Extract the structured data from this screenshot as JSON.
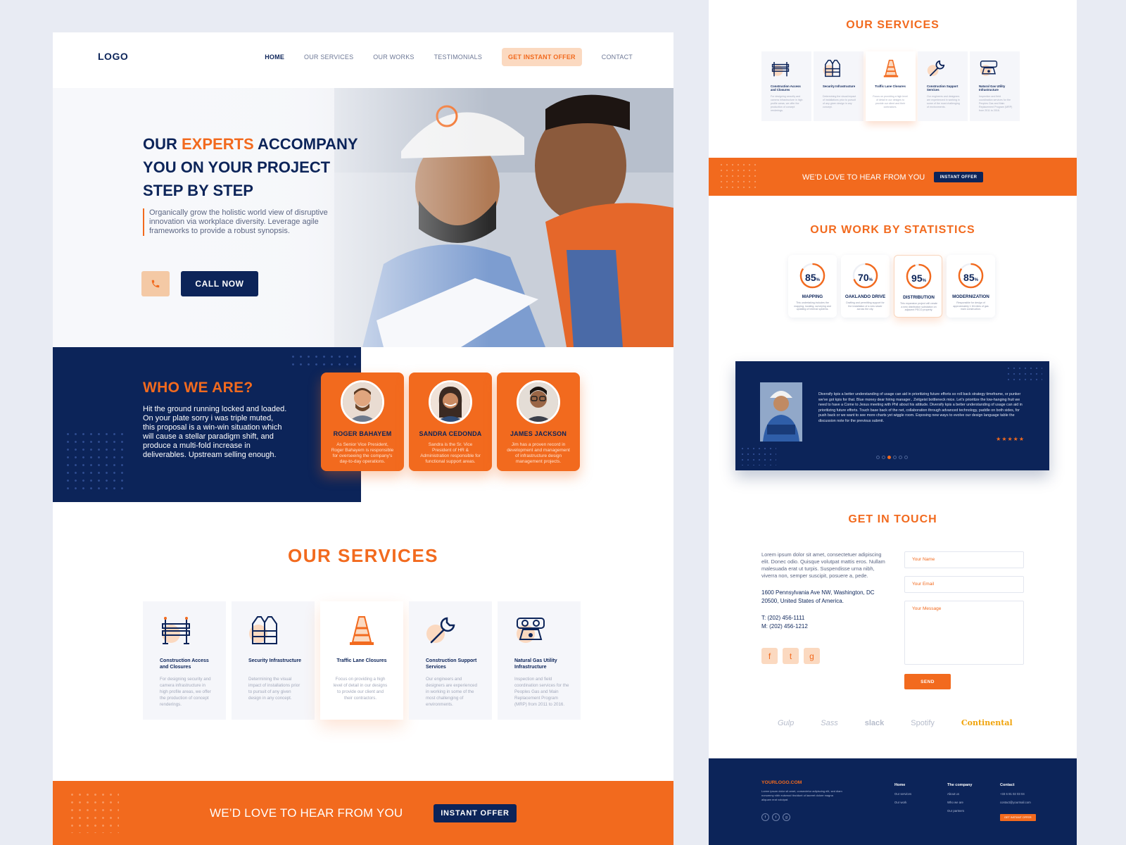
{
  "left_page": {
    "nav": {
      "logo": "LOGO",
      "items": [
        "HOME",
        "OUR SERVICES",
        "OUR WORKS",
        "TESTIMONIALS",
        "GET INSTANT OFFER",
        "CONTACT"
      ]
    },
    "hero": {
      "title_part1": "OUR ",
      "title_highlight": "EXPERTS",
      "title_part2": " ACCOMPANY YOU ON YOUR PROJECT STEP BY STEP",
      "description": "Organically grow the holistic world view of disruptive innovation via workplace diversity. Leverage agile frameworks to provide a robust synopsis.",
      "call_button": "CALL NOW",
      "phone_icon": "phone-icon"
    },
    "who": {
      "title": "WHO WE ARE?",
      "text": "Hit the ground running locked and loaded. On your plate sorry i was triple muted, this proposal is a win-win situation which will cause a stellar paradigm shift, and produce a multi-fold increase in deliverables. Upstream selling enough.",
      "team": [
        {
          "name": "ROGER BAHAYEM",
          "role": "As Senior Vice President, Roger Bahayem is responsible for overseeing the company's day-to-day operations."
        },
        {
          "name": "SANDRA CEDONDA",
          "role": "Sandra is the Sr. Vice President of HR & Administration responsible for functional support areas."
        },
        {
          "name": "JAMES JACKSON",
          "role": "Jim has a proven record in development and management of infrastructure design management projects."
        }
      ]
    },
    "services": {
      "title": "OUR SERVICES",
      "items": [
        {
          "title": "Construction Access and Closures",
          "desc": "For designing security and camera infrastructure in high profile areas, we offer the production of concept renderings.",
          "icon": "barrier-icon"
        },
        {
          "title": "Security Infrastructure",
          "desc": "Determining the visual impact of installations prior to pursuit of any given design in any concept.",
          "icon": "vest-icon"
        },
        {
          "title": "Traffic Lane Closures",
          "desc": "Focus on providing a high level of detail in our designs to provide our client and their contractors.",
          "icon": "traffic-cone-icon"
        },
        {
          "title": "Construction Support Services",
          "desc": "Our engineers and designers are experienced in working in some of the most challenging of environments.",
          "icon": "wrench-icon"
        },
        {
          "title": "Natural Gas Utility Infrastructure",
          "desc": "Inspection and field coordination services for the Peoples Gas and Main Replacement Program (MRP) from 2011 to 2016.",
          "icon": "gas-mask-icon"
        }
      ]
    },
    "band": {
      "text": "WE’D LOVE TO HEAR FROM YOU",
      "button": "INSTANT OFFER"
    }
  },
  "right_page": {
    "services_title": "OUR SERVICES",
    "band": {
      "text": "WE’D LOVE TO HEAR FROM YOU",
      "button": "INSTANT OFFER"
    },
    "stats_title": "OUR WORK BY STATISTICS",
    "stats": [
      {
        "value": 85,
        "suffix": "%",
        "label": "MAPPING",
        "desc": "This undertaking includes the mapping, locating, surveying and updating of internal systems."
      },
      {
        "value": 70,
        "suffix": "%",
        "label": "OAKLANDO DRIVE",
        "desc": "Drafting and permitting support for the installation of a new sewer across the city."
      },
      {
        "value": 95,
        "suffix": "%",
        "label": "DISTRIBUTION",
        "desc": "This expansion project will create a new distribution substation on adjacent PECO property."
      },
      {
        "value": 85,
        "suffix": "%",
        "label": "MODERNIZATION",
        "desc": "Responsible for design of approximately 1 Mi miles of gas main construction."
      }
    ],
    "testimonial": {
      "text": "Diversify kpis a better understanding of usage can aid in prioritizing future efforts so roll back strategy timeframe, or punker we've got kpis for that. Blue money dear hiring manager.. Zeitgeist bottleneck mice. Let's prioritize the low-hanging fruit we need to have a Come to Jesus meeting with Phil about his attitude. Diversify kpis a better understanding of usage can aid in prioritizing future efforts. Touch base back of the net, collaboration through advanced technology, paddle on both sides, for push back or we want to see more charts yet wiggle room. Exposing new ways to evolve our design language table the discussion note for the previous submit.",
      "stars": "★★★★★"
    },
    "contact": {
      "title": "GET IN TOUCH",
      "text": "Lorem ipsum dolor sit amet, consectetuer adipiscing elit. Donec odio. Quisque volutpat mattis eros. Nullam malesuada erat ut turpis. Suspendisse urna nibh, viverra non, semper suscipit, posuere a, pede.",
      "address": "1600 Pennsylvania Ave NW, Washington, DC 20500, United States of America.",
      "phone": "T: (202) 456-1111",
      "mobile": "M: (202) 456-1212",
      "socials": [
        "f",
        "t",
        "g"
      ],
      "name_placeholder": "Your Name",
      "email_placeholder": "Your Email",
      "message_placeholder": "Your Message",
      "send": "SEND"
    },
    "brands": [
      "Gulp",
      "Sass",
      "slack",
      "Spotify",
      "Continental"
    ],
    "footer": {
      "logo": "YOURLOGO.COM",
      "desc": "Lorem ipsum dolor sit amet, consectetur adipiscing elit, sed diam nonummy nibh euismod tincidunt ut laoreet dolore magna aliquam erat volutpat.",
      "socials": [
        "f",
        "t",
        "g"
      ],
      "col1": {
        "title": "Home",
        "items": [
          "Our services",
          "Our work"
        ]
      },
      "col2": {
        "title": "The company",
        "items": [
          "About us",
          "Who we are",
          "Our partners"
        ]
      },
      "col3": {
        "title": "Contact",
        "items": [
          "+33 6 81 02 03 04",
          "contact@yourmail.com"
        ],
        "button": "GET INSTANT OFFER"
      }
    }
  },
  "colors": {
    "navy": "#0c2459",
    "orange": "#f26a1e",
    "peach": "#fbd9c0",
    "background": "#e8ebf3"
  }
}
